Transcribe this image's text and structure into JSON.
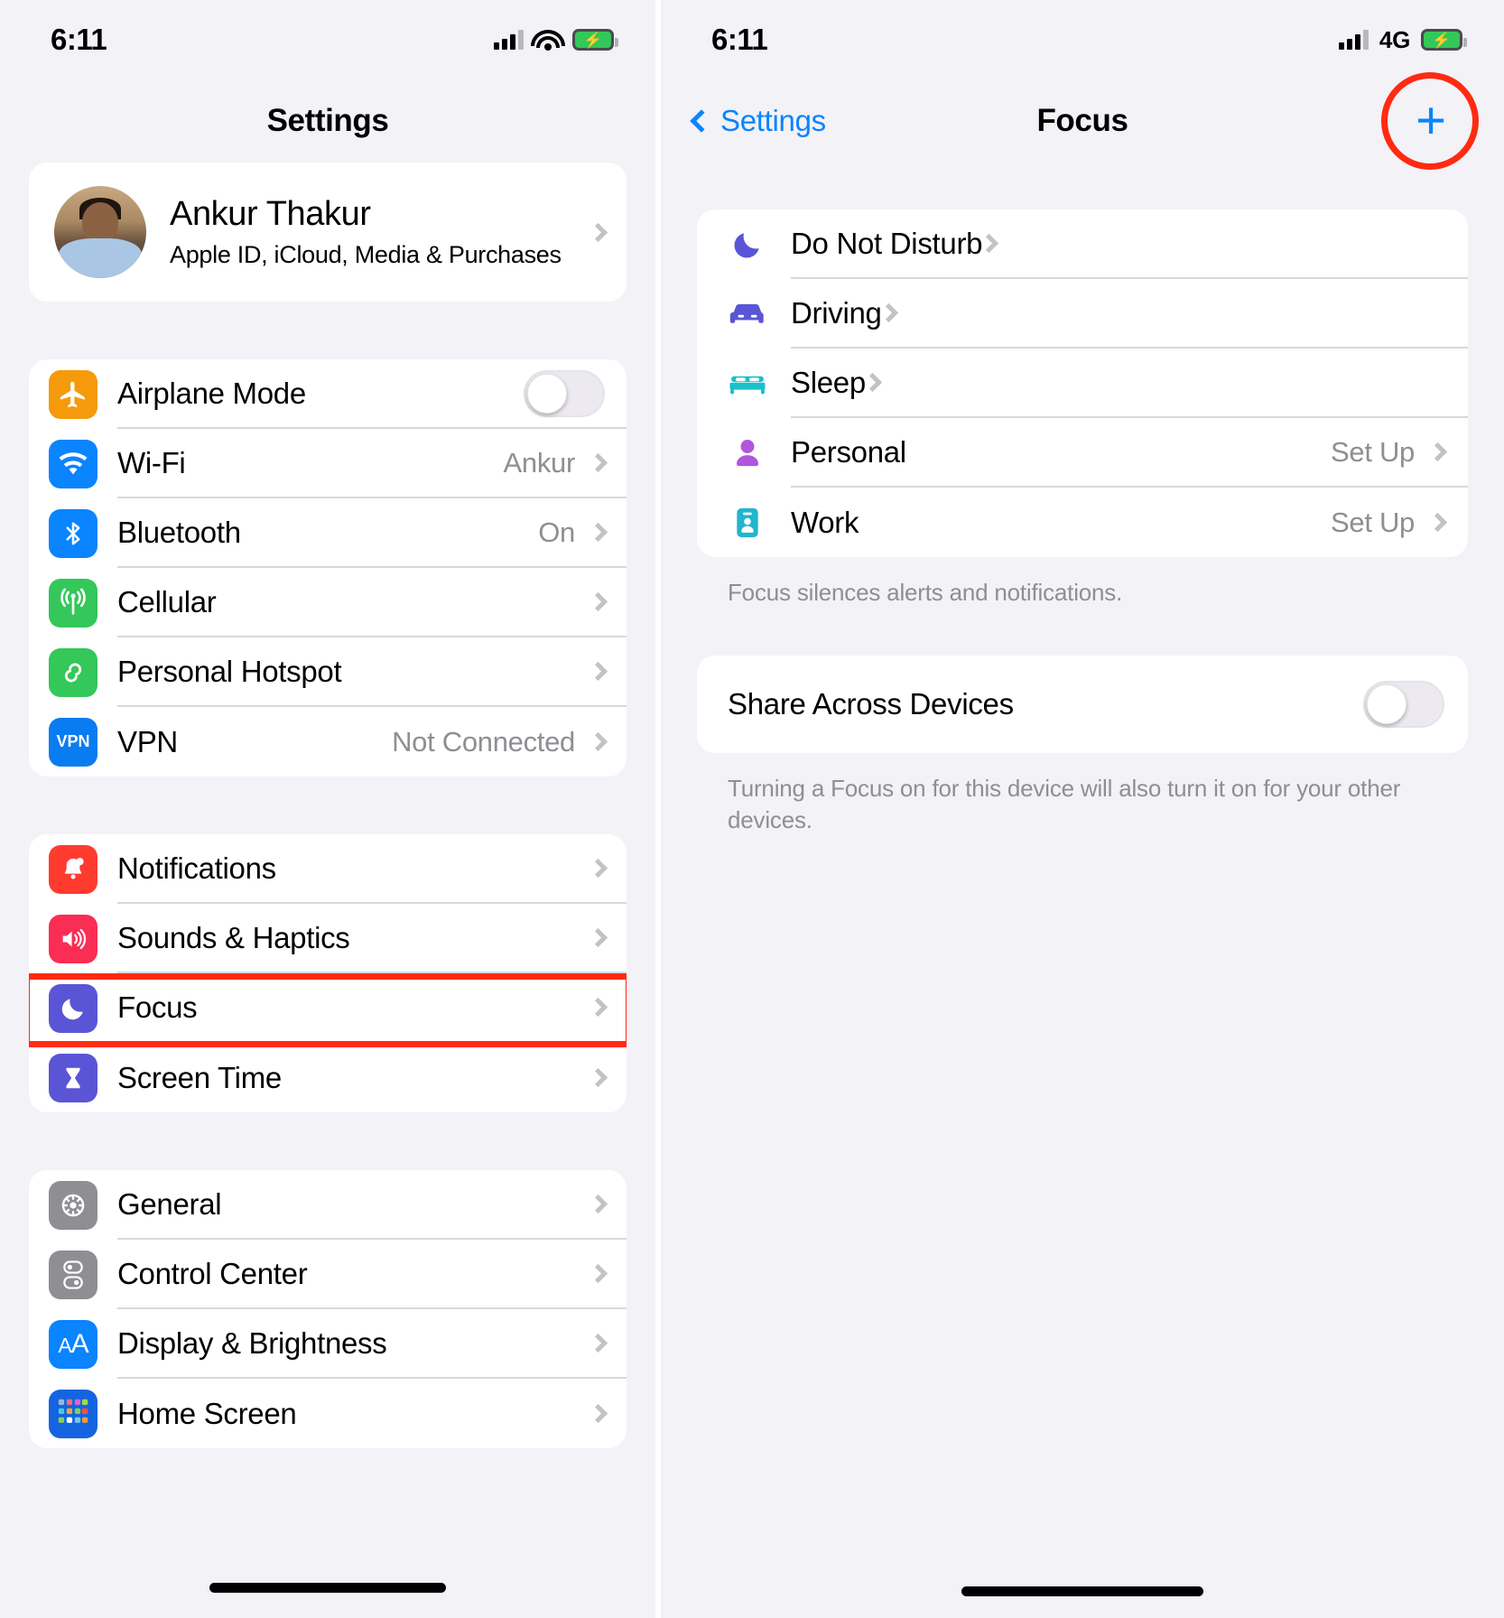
{
  "colors": {
    "accent_blue": "#0a84ff",
    "highlight_red": "#ff2a12",
    "gray_text": "#8e8e93",
    "page_bg": "#f2f2f7"
  },
  "left_screen": {
    "status": {
      "time": "6:11",
      "network": "",
      "battery_charging": true
    },
    "nav": {
      "title": "Settings"
    },
    "profile": {
      "name": "Ankur Thakur",
      "subtitle": "Apple ID, iCloud, Media & Purchases"
    },
    "group_connectivity": [
      {
        "label": "Airplane Mode",
        "value": "",
        "control": "toggle",
        "toggle_on": false,
        "icon": "airplane-icon",
        "icon_bg": "#f59a0b"
      },
      {
        "label": "Wi-Fi",
        "value": "Ankur",
        "control": "chevron",
        "icon": "wifi-icon",
        "icon_bg": "#0a84ff"
      },
      {
        "label": "Bluetooth",
        "value": "On",
        "control": "chevron",
        "icon": "bluetooth-icon",
        "icon_bg": "#0a84ff"
      },
      {
        "label": "Cellular",
        "value": "",
        "control": "chevron",
        "icon": "cellular-icon",
        "icon_bg": "#34c759"
      },
      {
        "label": "Personal Hotspot",
        "value": "",
        "control": "chevron",
        "icon": "hotspot-icon",
        "icon_bg": "#34c759"
      },
      {
        "label": "VPN",
        "value": "Not Connected",
        "control": "chevron",
        "icon": "vpn-icon",
        "icon_bg": "#0a7cf2"
      }
    ],
    "group_alerts": [
      {
        "label": "Notifications",
        "value": "",
        "control": "chevron",
        "icon": "notifications-bell-icon",
        "icon_bg": "#ff3b30"
      },
      {
        "label": "Sounds & Haptics",
        "value": "",
        "control": "chevron",
        "icon": "speaker-icon",
        "icon_bg": "#fa2d55"
      },
      {
        "label": "Focus",
        "value": "",
        "control": "chevron",
        "icon": "moon-icon",
        "icon_bg": "#5a55d6",
        "highlighted": true
      },
      {
        "label": "Screen Time",
        "value": "",
        "control": "chevron",
        "icon": "hourglass-icon",
        "icon_bg": "#5a55d6"
      }
    ],
    "group_system": [
      {
        "label": "General",
        "value": "",
        "control": "chevron",
        "icon": "gear-icon",
        "icon_bg": "#8e8e93"
      },
      {
        "label": "Control Center",
        "value": "",
        "control": "chevron",
        "icon": "control-center-icon",
        "icon_bg": "#8e8e93"
      },
      {
        "label": "Display & Brightness",
        "value": "",
        "control": "chevron",
        "icon": "display-brightness-icon",
        "icon_bg": "#0a84ff"
      },
      {
        "label": "Home Screen",
        "value": "",
        "control": "chevron",
        "icon": "home-screen-icon",
        "icon_bg": "#1464e0"
      }
    ]
  },
  "right_screen": {
    "status": {
      "time": "6:11",
      "network": "4G",
      "battery_charging": true
    },
    "nav": {
      "back_label": "Settings",
      "title": "Focus",
      "add_button_label": "+",
      "add_button_highlighted": true
    },
    "focus_modes": [
      {
        "label": "Do Not Disturb",
        "value": "",
        "icon": "moon-icon",
        "icon_color": "#5a55d6"
      },
      {
        "label": "Driving",
        "value": "",
        "icon": "car-icon",
        "icon_color": "#5a55d6"
      },
      {
        "label": "Sleep",
        "value": "",
        "icon": "bed-icon",
        "icon_color": "#19c0cc"
      },
      {
        "label": "Personal",
        "value": "Set Up",
        "icon": "person-icon",
        "icon_color": "#b255dd"
      },
      {
        "label": "Work",
        "value": "Set Up",
        "icon": "badge-id-icon",
        "icon_color": "#22b5ce"
      }
    ],
    "focus_footnote": "Focus silences alerts and notifications.",
    "share": {
      "label": "Share Across Devices",
      "toggle_on": false,
      "footnote": "Turning a Focus on for this device will also turn it on for your other devices."
    }
  }
}
